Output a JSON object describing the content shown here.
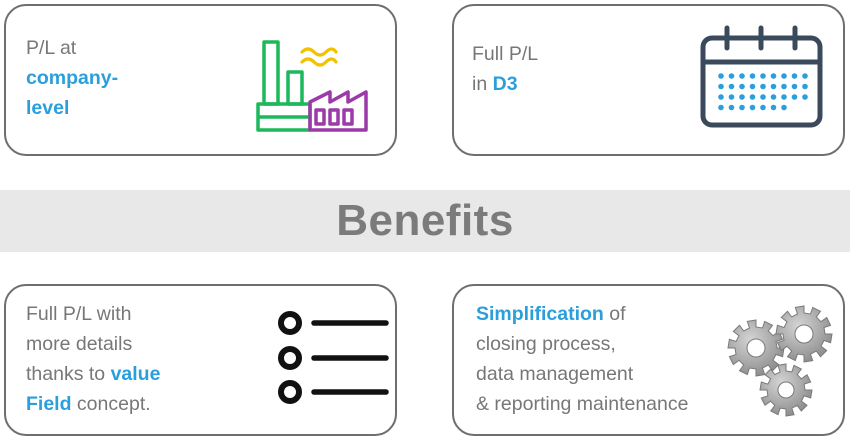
{
  "cards": [
    {
      "lines": [
        [
          "P/L at",
          ""
        ],
        [
          "company-",
          "hl"
        ],
        [
          "level",
          "hl"
        ]
      ],
      "icon": "factory-icon"
    },
    {
      "lines": [
        [
          "Full P/L",
          ""
        ],
        [
          "in ",
          "",
          "D3",
          "hl"
        ]
      ],
      "icon": "calendar-icon"
    },
    {
      "lines": [
        [
          "Full P/L with",
          ""
        ],
        [
          "more details",
          ""
        ],
        [
          "thanks to ",
          "",
          "value",
          "hl"
        ],
        [
          "Field",
          "hl",
          " concept.",
          ""
        ]
      ],
      "icon": "list-icon"
    },
    {
      "lines": [
        [
          "Simplification",
          "hl",
          " of",
          ""
        ],
        [
          "closing process,",
          ""
        ],
        [
          "data management",
          ""
        ],
        [
          "& reporting maintenance",
          ""
        ]
      ],
      "icon": "gears-icon"
    }
  ],
  "card1": {
    "l1": "P/L at",
    "l2": "company-",
    "l3": "level"
  },
  "card2": {
    "l1": "Full P/L",
    "l2a": "in ",
    "l2b": "D3"
  },
  "card3": {
    "l1": "Full P/L with",
    "l2": "more details",
    "l3a": "thanks to ",
    "l3b": "value",
    "l4a": "Field",
    "l4b": " concept."
  },
  "card4": {
    "l1a": "Simplification",
    "l1b": " of",
    "l2": "closing process,",
    "l3": "data management",
    "l4": "& reporting maintenance"
  },
  "banner": {
    "title": "Benefits"
  },
  "colors": {
    "accent": "#2a9fdb",
    "text": "#777777",
    "border": "#6e6e6e",
    "banner_bg": "#e8e8e8",
    "factory_green": "#1db85a",
    "factory_purple": "#9b3aa8",
    "factory_yellow": "#f2c200",
    "calendar_dark": "#3a4a5c",
    "calendar_dots": "#2a9fdb",
    "gear": "#9a9a9a"
  }
}
